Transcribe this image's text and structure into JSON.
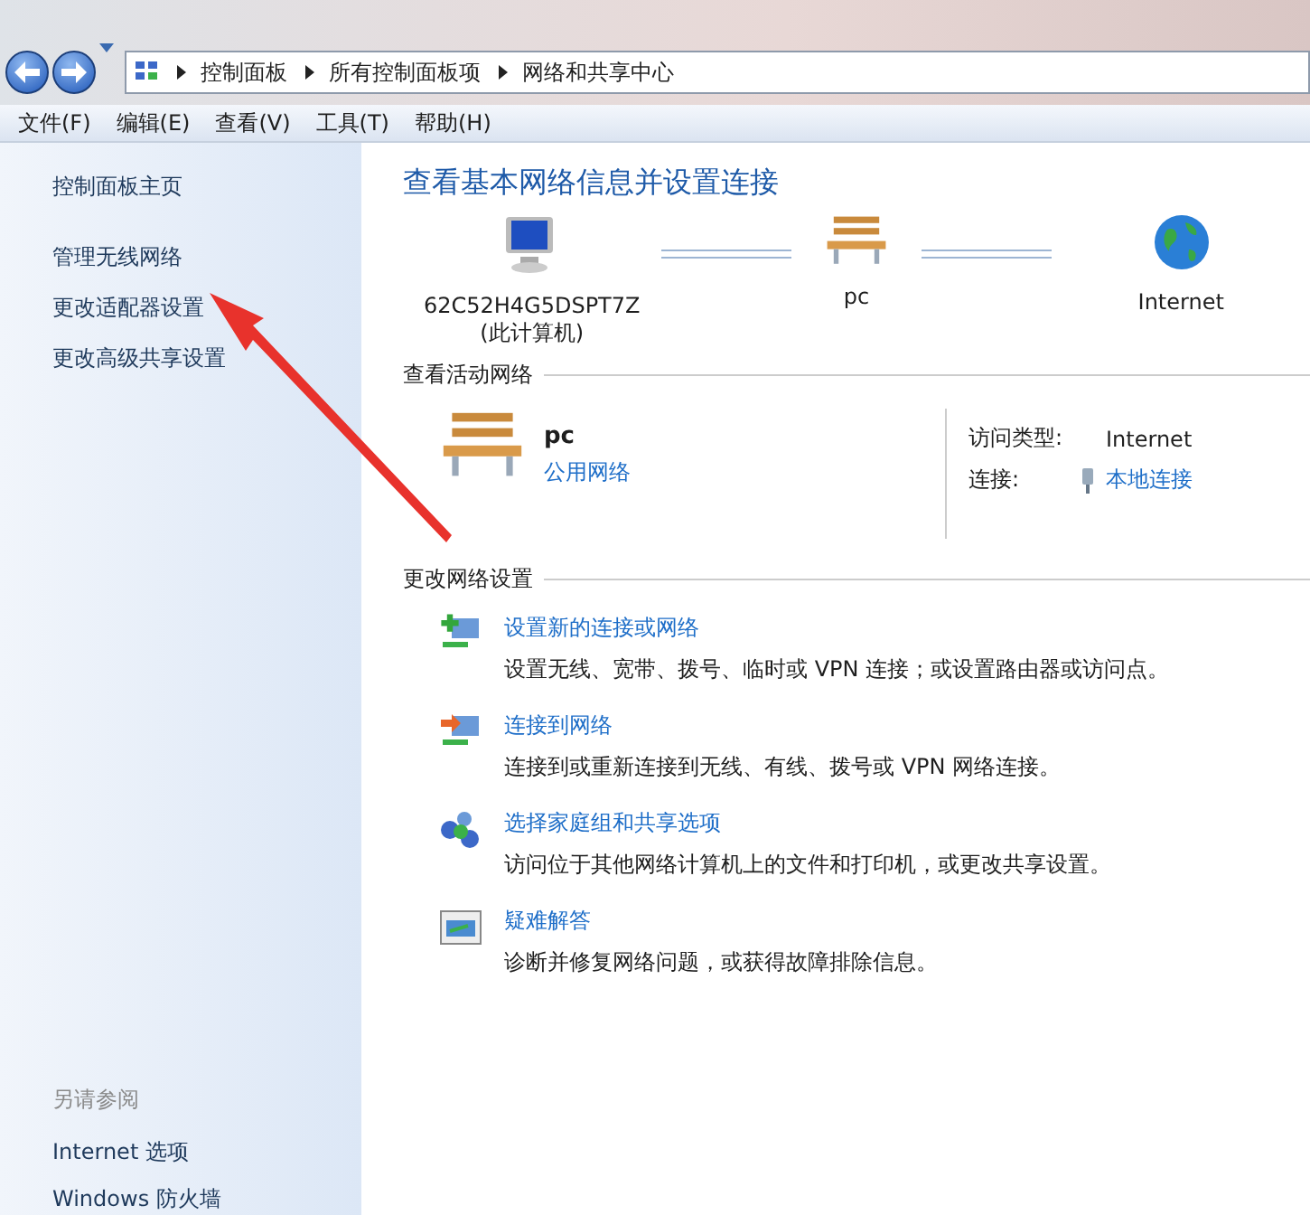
{
  "breadcrumb": [
    "控制面板",
    "所有控制面板项",
    "网络和共享中心"
  ],
  "menu": [
    "文件(F)",
    "编辑(E)",
    "查看(V)",
    "工具(T)",
    "帮助(H)"
  ],
  "sidebar": {
    "items": [
      {
        "label": "控制面板主页"
      },
      {
        "label": "管理无线网络"
      },
      {
        "label": "更改适配器设置"
      },
      {
        "label": "更改高级共享设置"
      }
    ],
    "see_also_title": "另请参阅",
    "see_also": [
      "Internet 选项",
      "Windows 防火墙"
    ]
  },
  "main": {
    "title": "查看基本网络信息并设置连接",
    "map": [
      {
        "kind": "computer",
        "label": "62C52H4G5DSPT7Z",
        "sublabel": "(此计算机)"
      },
      {
        "kind": "bench",
        "label": "pc"
      },
      {
        "kind": "globe",
        "label": "Internet"
      }
    ],
    "active_networks": {
      "heading": "查看活动网络",
      "name": "pc",
      "type_link": "公用网络",
      "access_label": "访问类型:",
      "access_value": "Internet",
      "connection_label": "连接:",
      "connection_value": "本地连接"
    },
    "change_settings": {
      "heading": "更改网络设置",
      "tasks": [
        {
          "kind": "new",
          "link": "设置新的连接或网络",
          "description": "设置无线、宽带、拨号、临时或 VPN 连接；或设置路由器或访问点。"
        },
        {
          "kind": "connect",
          "link": "连接到网络",
          "description": "连接到或重新连接到无线、有线、拨号或 VPN 网络连接。"
        },
        {
          "kind": "homegroup",
          "link": "选择家庭组和共享选项",
          "description": "访问位于其他网络计算机上的文件和打印机，或更改共享设置。"
        },
        {
          "kind": "troubleshoot",
          "link": "疑难解答",
          "description": "诊断并修复网络问题，或获得故障排除信息。"
        }
      ]
    }
  }
}
